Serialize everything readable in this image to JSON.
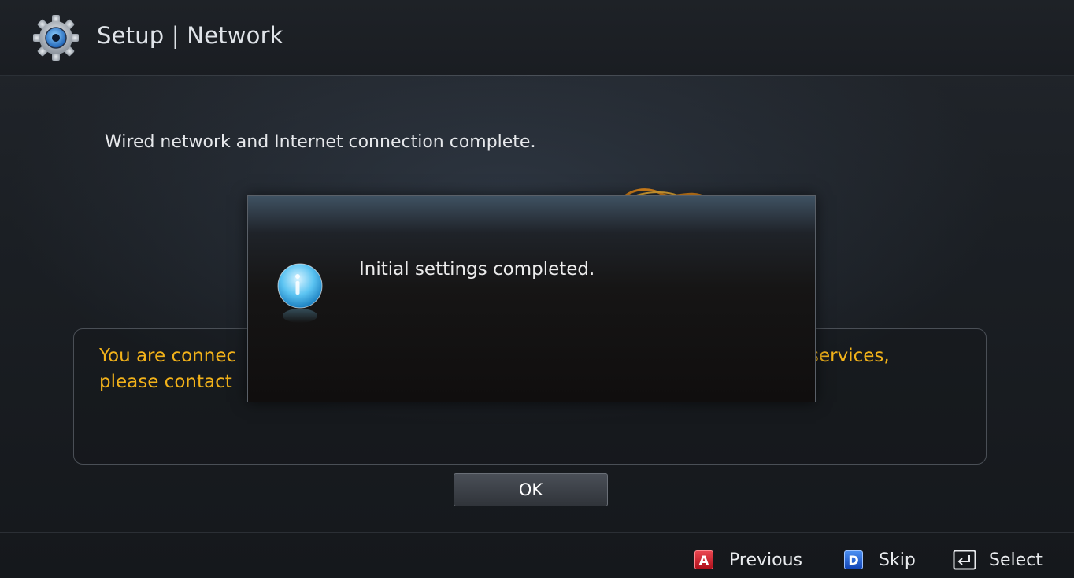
{
  "header": {
    "title": "Setup | Network",
    "icon": "gear-icon"
  },
  "main": {
    "status_message": "Wired network and Internet connection complete.",
    "info_text_line1": "You are connec",
    "info_text_line1_end": "services,",
    "info_text_line2": "please contact",
    "ok_label": "OK"
  },
  "popup": {
    "icon": "info-icon",
    "message": "Initial settings completed."
  },
  "footer": {
    "previous": {
      "key": "A",
      "label": "Previous",
      "color": "#d8202b"
    },
    "skip": {
      "key": "D",
      "label": "Skip",
      "color": "#2563d6"
    },
    "select": {
      "icon": "enter-icon",
      "label": "Select"
    }
  },
  "colors": {
    "accent_text": "#f2b21a",
    "background": "#15181c"
  }
}
